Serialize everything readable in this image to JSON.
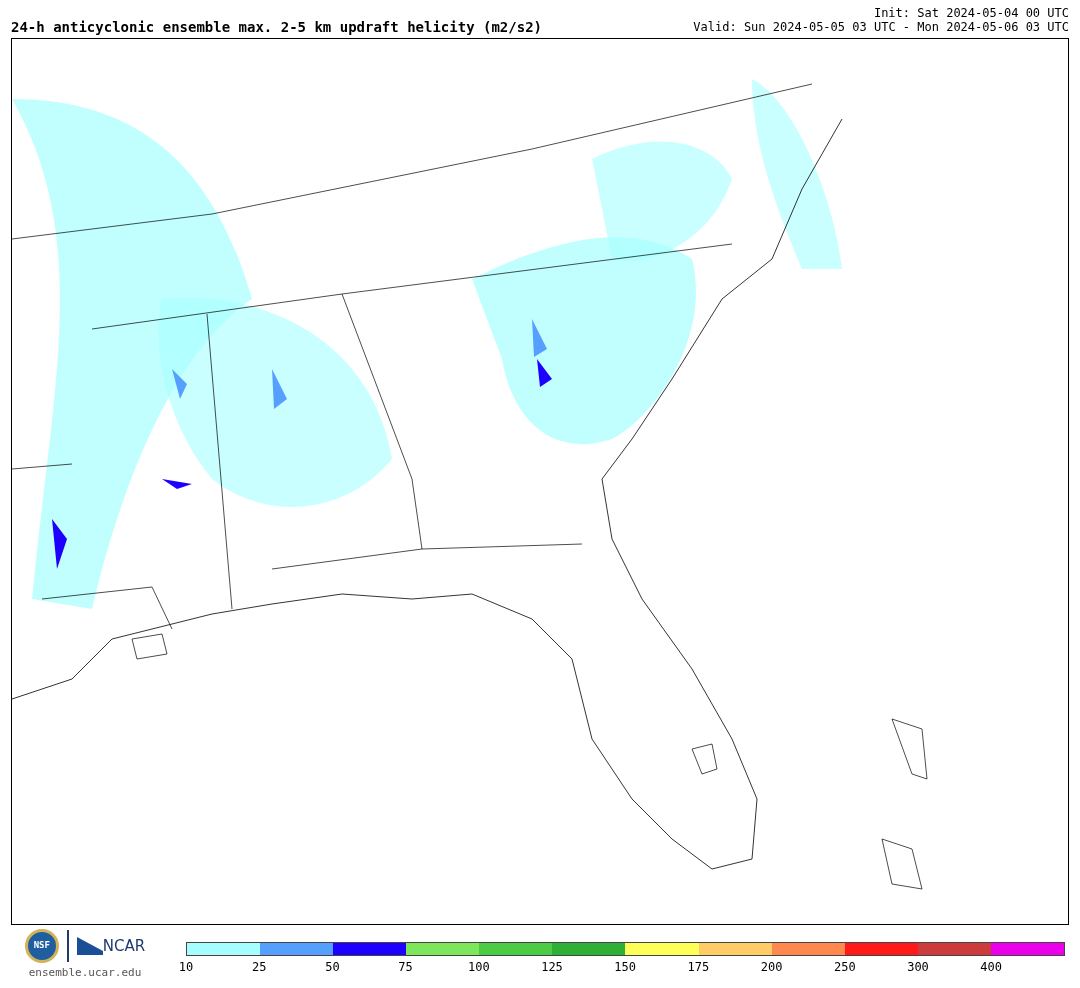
{
  "title": "24-h anticyclonic ensemble max. 2-5 km updraft helicity (m2/s2)",
  "init": "Init: Sat 2024-05-04 00 UTC",
  "valid": "Valid: Sun 2024-05-05 03 UTC - Mon 2024-05-06 03 UTC",
  "logos": {
    "seal": "NSF",
    "wordmark": "NCAR",
    "url": "ensemble.ucar.edu"
  },
  "colorbar": {
    "bins": [
      {
        "color": "#a6ffff"
      },
      {
        "color": "#55a0ff"
      },
      {
        "color": "#1e00ff"
      },
      {
        "color": "#7ee65a"
      },
      {
        "color": "#4ccc44"
      },
      {
        "color": "#2eb036"
      },
      {
        "color": "#ffff5a"
      },
      {
        "color": "#ffcc66"
      },
      {
        "color": "#ff884e"
      },
      {
        "color": "#ff1a1a"
      },
      {
        "color": "#cc3c3c"
      },
      {
        "color": "#ea00ea"
      }
    ],
    "ticks": [
      "10",
      "25",
      "50",
      "75",
      "100",
      "125",
      "150",
      "175",
      "200",
      "250",
      "300",
      "400"
    ]
  }
}
